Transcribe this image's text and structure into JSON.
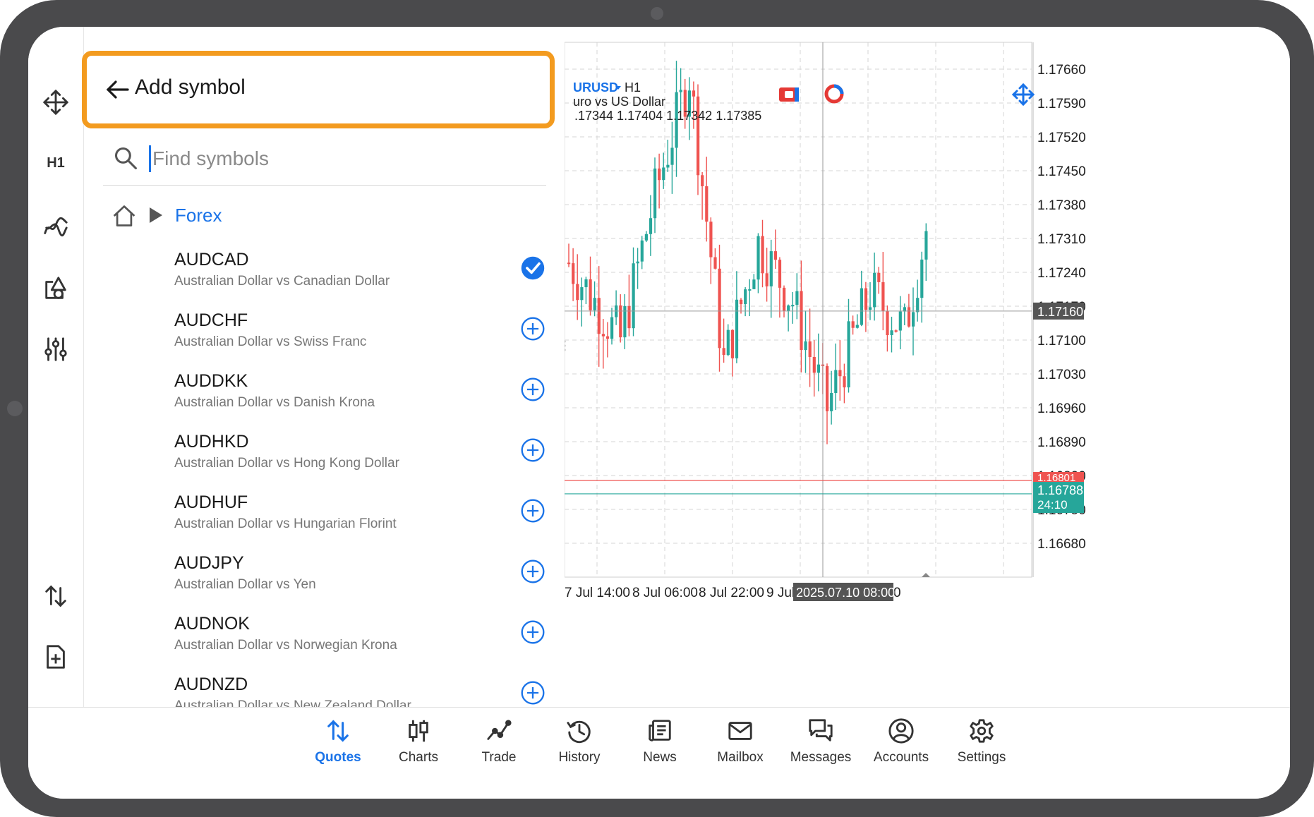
{
  "header": {
    "title": "Add symbol"
  },
  "search": {
    "placeholder": "Find symbols",
    "value": ""
  },
  "breadcrumb": {
    "current": "Forex"
  },
  "toolbar": {
    "timeframe": "H1"
  },
  "symbols": [
    {
      "name": "AUDCAD",
      "description": "Australian Dollar vs Canadian Dollar",
      "added": true
    },
    {
      "name": "AUDCHF",
      "description": "Australian Dollar vs Swiss Franc",
      "added": false
    },
    {
      "name": "AUDDKK",
      "description": "Australian Dollar vs Danish Krona",
      "added": false
    },
    {
      "name": "AUDHKD",
      "description": "Australian Dollar vs Hong Kong Dollar",
      "added": false
    },
    {
      "name": "AUDHUF",
      "description": "Australian Dollar vs Hungarian Florint",
      "added": false
    },
    {
      "name": "AUDJPY",
      "description": "Australian Dollar vs Yen",
      "added": false
    },
    {
      "name": "AUDNOK",
      "description": "Australian Dollar vs Norwegian Krona",
      "added": false
    },
    {
      "name": "AUDNZD",
      "description": "Australian Dollar vs New Zealand Dollar",
      "added": false
    }
  ],
  "chart": {
    "symbol": "URUSD",
    "timeframe": "H1",
    "description": "uro vs US Dollar",
    "ohlc": ".17344 1.17404 1.17342 1.17385",
    "price_levels": [
      "1.17660",
      "1.17590",
      "1.17520",
      "1.17450",
      "1.17380",
      "1.17310",
      "1.17240",
      "1.17170",
      "1.17100",
      "1.17030",
      "1.16960",
      "1.16890",
      "1.16820",
      "1.16750",
      "1.16680"
    ],
    "crosshair_price": "1.17160",
    "ask_price": "1.16801",
    "bid_price": "1.16788",
    "countdown": "24:10",
    "time_labels": [
      "7 Jul 14:00",
      "8 Jul 06:00",
      "8 Jul 22:00",
      "9 Jul",
      "0"
    ],
    "crosshair_time": "2025.07.10 08:00",
    "colors": {
      "bull": "#26a69a",
      "bear": "#ef5350",
      "grid": "#d6d6d6"
    }
  },
  "nav": [
    {
      "label": "Quotes",
      "icon": "quotes-icon",
      "active": true
    },
    {
      "label": "Charts",
      "icon": "charts-icon",
      "active": false
    },
    {
      "label": "Trade",
      "icon": "trade-icon",
      "active": false
    },
    {
      "label": "History",
      "icon": "history-icon",
      "active": false
    },
    {
      "label": "News",
      "icon": "news-icon",
      "active": false
    },
    {
      "label": "Mailbox",
      "icon": "mailbox-icon",
      "active": false
    },
    {
      "label": "Messages",
      "icon": "messages-icon",
      "active": false
    },
    {
      "label": "Accounts",
      "icon": "accounts-icon",
      "active": false
    },
    {
      "label": "Settings",
      "icon": "settings-icon",
      "active": false
    }
  ]
}
